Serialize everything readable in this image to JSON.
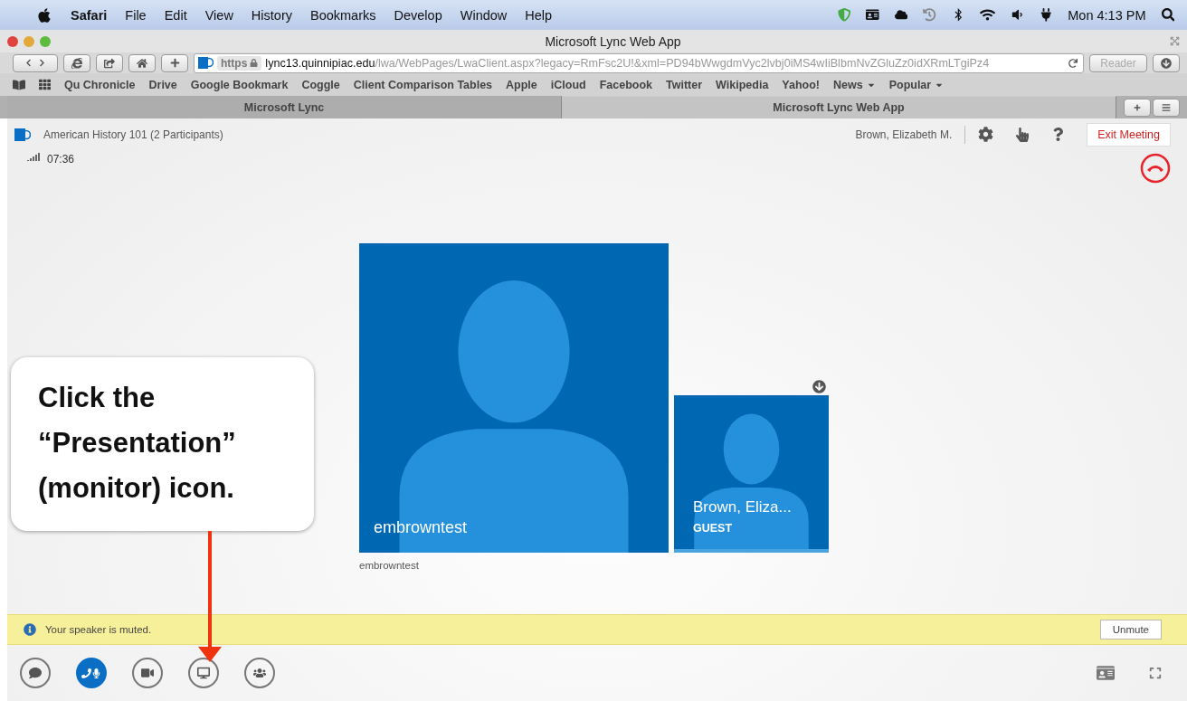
{
  "menubar": {
    "app": "Safari",
    "items": [
      "File",
      "Edit",
      "View",
      "History",
      "Bookmarks",
      "Develop",
      "Window",
      "Help"
    ],
    "clock": "Mon 4:13 PM"
  },
  "window": {
    "title": "Microsoft Lync Web App"
  },
  "address": {
    "scheme": "https",
    "host": "lync13.quinnipiac.edu",
    "path": "/lwa/WebPages/LwaClient.aspx?legacy=RmFsc2U!&xml=PD94bWwgdmVyc2lvbj0iMS4wIiBlbmNvZGluZz0idXRmLTgiPz4",
    "reader": "Reader"
  },
  "bookmarks": [
    {
      "label": "Qu Chronicle",
      "dropdown": false
    },
    {
      "label": "Drive",
      "dropdown": false
    },
    {
      "label": "Google Bookmark",
      "dropdown": false
    },
    {
      "label": "Coggle",
      "dropdown": false
    },
    {
      "label": "Client Comparison Tables",
      "dropdown": false
    },
    {
      "label": "Apple",
      "dropdown": false
    },
    {
      "label": "iCloud",
      "dropdown": false
    },
    {
      "label": "Facebook",
      "dropdown": false
    },
    {
      "label": "Twitter",
      "dropdown": false
    },
    {
      "label": "Wikipedia",
      "dropdown": false
    },
    {
      "label": "Yahoo!",
      "dropdown": false
    },
    {
      "label": "News",
      "dropdown": true
    },
    {
      "label": "Popular",
      "dropdown": true
    }
  ],
  "tabs": [
    {
      "label": "Microsoft Lync",
      "selected": false
    },
    {
      "label": "Microsoft Lync Web App",
      "selected": true
    }
  ],
  "meeting": {
    "title": "American History 101 (2 Participants)",
    "user": "Brown, Elizabeth M.",
    "exit": "Exit Meeting",
    "duration": "07:36"
  },
  "participants": [
    {
      "kind": "large",
      "name": "embrowntest",
      "caption": "embrowntest"
    },
    {
      "kind": "small",
      "name": "Brown, Eliza...",
      "role": "GUEST"
    }
  ],
  "notification": {
    "text": "Your speaker is muted.",
    "action": "Unmute"
  },
  "toolbar": [
    {
      "kind": "chat",
      "selected": false
    },
    {
      "kind": "audio",
      "selected": true
    },
    {
      "kind": "video",
      "selected": false
    },
    {
      "kind": "present",
      "selected": false
    },
    {
      "kind": "people",
      "selected": false
    }
  ],
  "callout": {
    "text": "Click the “Presentation” (monitor) icon."
  }
}
